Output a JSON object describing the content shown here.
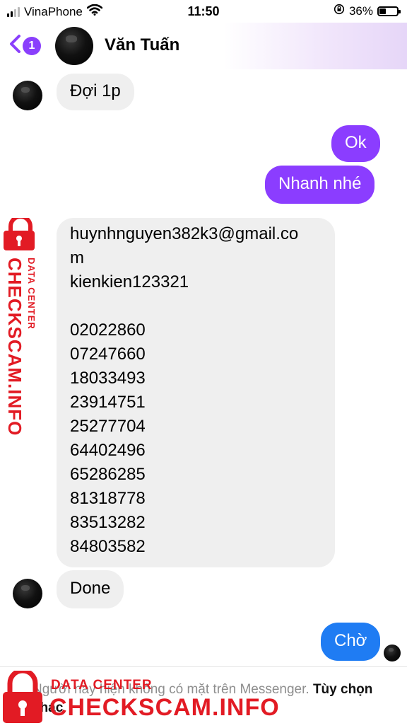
{
  "status": {
    "carrier": "VinaPhone",
    "time": "11:50",
    "battery": "36%",
    "battery_level": 0.36,
    "icons": [
      "signal-icon",
      "wifi-icon",
      "orientation-lock-icon",
      "battery-icon"
    ]
  },
  "header": {
    "back_badge": "1",
    "contact_name": "Văn Tuấn"
  },
  "messages": [
    {
      "side": "in",
      "text": "Đợi 1p"
    },
    {
      "side": "out",
      "text": "Ok"
    },
    {
      "side": "out",
      "text": "Nhanh nhé"
    },
    {
      "side": "in",
      "text": "huynhnguyen382k3@gmail.co\nm\nkienkien123321\n\n02022860\n07247660\n18033493\n23914751\n25277704\n64402496\n65286285\n81318778\n83513282\n84803582"
    },
    {
      "side": "in",
      "text": "Done"
    },
    {
      "side": "out",
      "text": "Chờ"
    }
  ],
  "footer": {
    "notice": "Người này hiện không có mặt trên Messenger.",
    "options_link": "Tùy chọn khác"
  },
  "watermark": {
    "small": "DATA CENTER",
    "big": "CHECKSCAM.INFO"
  },
  "colors": {
    "accent_purple": "#8b3dff",
    "accent_blue": "#1f7cf3",
    "incoming_bubble": "#efefef",
    "watermark_red": "#e21b24"
  }
}
